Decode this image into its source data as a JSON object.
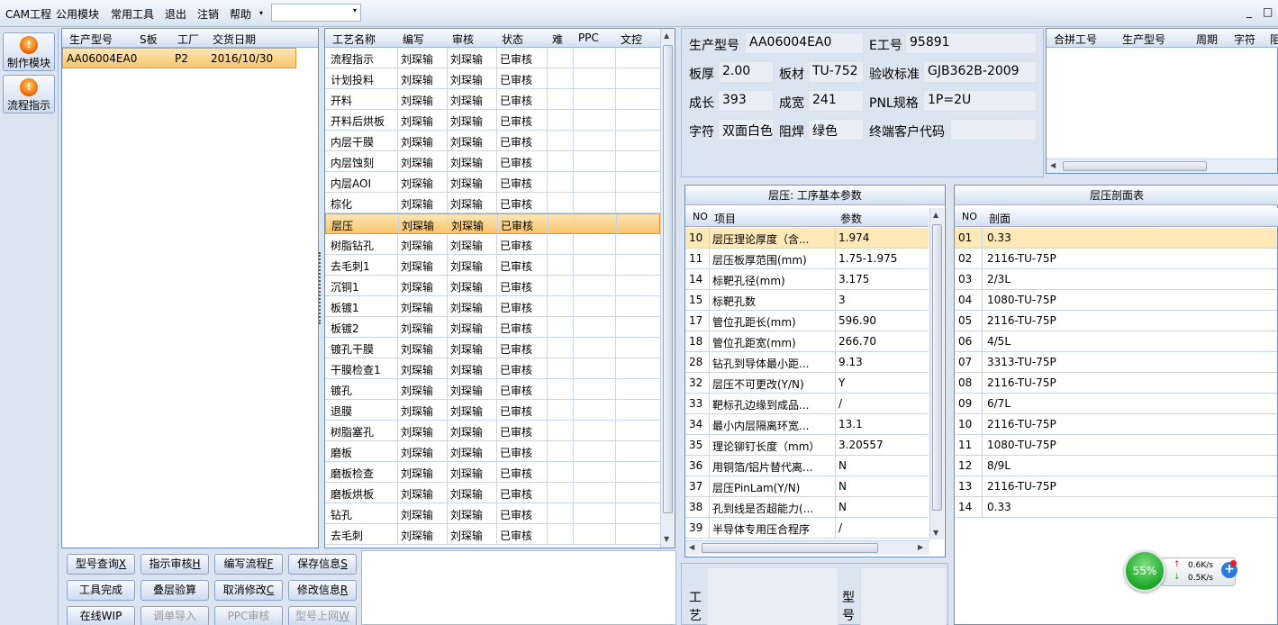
{
  "menu": {
    "items": [
      "CAM工程",
      "公用模块",
      "常用工具",
      "退出",
      "注销",
      "帮助"
    ],
    "dropdown_arrow": "▾",
    "minimize": "_",
    "maximize": "□"
  },
  "toolbar": {
    "make_module": "制作模块",
    "flow_guide": "流程指示",
    "icon_char": "!"
  },
  "orders": {
    "columns": [
      "生产型号",
      "S板",
      "工厂",
      "交货日期"
    ],
    "rows": [
      {
        "model": "AA06004EA0",
        "s": "",
        "factory": "P2",
        "date": "2016/10/30"
      }
    ]
  },
  "process": {
    "columns": [
      "工艺名称",
      "编写",
      "审核",
      "状态",
      "难",
      "PPC",
      "文控"
    ],
    "rows": [
      [
        "流程指示",
        "刘琛输",
        "刘琛输",
        "已审核"
      ],
      [
        "计划投料",
        "刘琛输",
        "刘琛输",
        "已审核"
      ],
      [
        "开料",
        "刘琛输",
        "刘琛输",
        "已审核"
      ],
      [
        "开料后烘板",
        "刘琛输",
        "刘琛输",
        "已审核"
      ],
      [
        "内层干膜",
        "刘琛输",
        "刘琛输",
        "已审核"
      ],
      [
        "内层蚀刻",
        "刘琛输",
        "刘琛输",
        "已审核"
      ],
      [
        "内层AOI",
        "刘琛输",
        "刘琛输",
        "已审核"
      ],
      [
        "棕化",
        "刘琛输",
        "刘琛输",
        "已审核"
      ],
      [
        "层压",
        "刘琛输",
        "刘琛输",
        "已审核"
      ],
      [
        "树脂钻孔",
        "刘琛输",
        "刘琛输",
        "已审核"
      ],
      [
        "去毛刺1",
        "刘琛输",
        "刘琛输",
        "已审核"
      ],
      [
        "沉铜1",
        "刘琛输",
        "刘琛输",
        "已审核"
      ],
      [
        "板镀1",
        "刘琛输",
        "刘琛输",
        "已审核"
      ],
      [
        "板镀2",
        "刘琛输",
        "刘琛输",
        "已审核"
      ],
      [
        "镀孔干膜",
        "刘琛输",
        "刘琛输",
        "已审核"
      ],
      [
        "干膜检查1",
        "刘琛输",
        "刘琛输",
        "已审核"
      ],
      [
        "镀孔",
        "刘琛输",
        "刘琛输",
        "已审核"
      ],
      [
        "退膜",
        "刘琛输",
        "刘琛输",
        "已审核"
      ],
      [
        "树脂塞孔",
        "刘琛输",
        "刘琛输",
        "已审核"
      ],
      [
        "磨板",
        "刘琛输",
        "刘琛输",
        "已审核"
      ],
      [
        "磨板检查",
        "刘琛输",
        "刘琛输",
        "已审核"
      ],
      [
        "磨板烘板",
        "刘琛输",
        "刘琛输",
        "已审核"
      ],
      [
        "钻孔",
        "刘琛输",
        "刘琛输",
        "已审核"
      ],
      [
        "去毛刺",
        "刘琛输",
        "刘琛输",
        "已审核"
      ]
    ]
  },
  "info": {
    "model_label": "生产型号",
    "model": "AA06004EA0",
    "eno_label": "E工号",
    "eno": "95891",
    "thick_label": "板厚",
    "thick": "2.00",
    "mat_label": "板材",
    "mat": "TU-752",
    "std_label": "验收标准",
    "std": "GJB362B-2009",
    "len_label": "成长",
    "len": "393",
    "wid_label": "成宽",
    "wid": "241",
    "pnl_label": "PNL规格",
    "pnl": "1P=2U",
    "char_label": "字符",
    "char": "双面白色",
    "mask_label": "阻焊",
    "mask": "绿色",
    "cust_label": "终端客户代码",
    "cust": ""
  },
  "merge": {
    "columns": [
      "合拼工号",
      "生产型号",
      "周期",
      "字符",
      "阻"
    ]
  },
  "params": {
    "title": "层压: 工序基本参数",
    "columns": [
      "NO",
      "项目",
      "参数"
    ],
    "rows": [
      [
        "10",
        "层压理论厚度（含...",
        "1.974"
      ],
      [
        "11",
        "层压板厚范围(mm)",
        "1.75-1.975"
      ],
      [
        "14",
        "标靶孔径(mm)",
        "3.175"
      ],
      [
        "15",
        "标靶孔数",
        "3"
      ],
      [
        "17",
        "管位孔距长(mm)",
        "596.90"
      ],
      [
        "18",
        "管位孔距宽(mm)",
        "266.70"
      ],
      [
        "28",
        "钻孔到导体最小距...",
        "9.13"
      ],
      [
        "32",
        "层压不可更改(Y/N)",
        "Y"
      ],
      [
        "33",
        "靶标孔边缘到成品...",
        "/"
      ],
      [
        "34",
        "最小内层隔离环宽...",
        "13.1"
      ],
      [
        "35",
        "理论铆钉长度（mm）",
        "3.20557"
      ],
      [
        "36",
        "用铜箔/铝片替代离...",
        "N"
      ],
      [
        "37",
        "层压PinLam(Y/N)",
        "N"
      ],
      [
        "38",
        "孔到线是否超能力(...",
        "N"
      ],
      [
        "39",
        "半导体专用压合程序",
        "/"
      ]
    ]
  },
  "stack": {
    "title": "层压剖面表",
    "columns": [
      "NO",
      "剖面"
    ],
    "rows": [
      [
        "01",
        "0.33"
      ],
      [
        "02",
        "2116-TU-75P"
      ],
      [
        "03",
        "2/3L"
      ],
      [
        "04",
        "1080-TU-75P"
      ],
      [
        "05",
        "2116-TU-75P"
      ],
      [
        "06",
        "4/5L"
      ],
      [
        "07",
        "3313-TU-75P"
      ],
      [
        "08",
        "2116-TU-75P"
      ],
      [
        "09",
        "6/7L"
      ],
      [
        "10",
        "2116-TU-75P"
      ],
      [
        "11",
        "1080-TU-75P"
      ],
      [
        "12",
        "8/9L"
      ],
      [
        "13",
        "2116-TU-75P"
      ],
      [
        "14",
        "0.33"
      ]
    ]
  },
  "buttons": {
    "b1": "型号查询",
    "b1k": "X",
    "b2": "指示审核",
    "b2k": "H",
    "b3": "编写流程",
    "b3k": "F",
    "b4": "保存信息",
    "b4k": "S",
    "b5": "工具完成",
    "b6": "叠层验算",
    "b7": "取消修改",
    "b7k": "C",
    "b8": "修改信息",
    "b8k": "R",
    "b9": "在线WIP",
    "b10": "调单导入",
    "b11": "PPC审核",
    "b12": "型号上网",
    "b12k": "W"
  },
  "bottom": {
    "craft": "工艺",
    "model": "型号"
  },
  "net": {
    "percent": "55%",
    "up": "0.6K/s",
    "down": "0.5K/s",
    "up_arrow": "↑",
    "down_arrow": "↓",
    "plus": "+"
  }
}
